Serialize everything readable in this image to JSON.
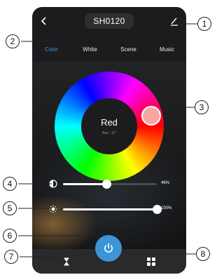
{
  "header": {
    "title": "SH0120",
    "back_icon": "chevron-left-icon",
    "edit_icon": "pencil-icon"
  },
  "tabs": [
    {
      "label": "Color",
      "active": true
    },
    {
      "label": "White",
      "active": false
    },
    {
      "label": "Scene",
      "active": false
    },
    {
      "label": "Music",
      "active": false
    }
  ],
  "color_wheel": {
    "color_name": "Red",
    "hue_label": "Hue : 11°"
  },
  "brightness": {
    "icon": "contrast-icon",
    "value_label": "46%",
    "value": 46
  },
  "warmth": {
    "icon": "sun-icon",
    "value_label": "100%",
    "value": 100
  },
  "bottom_bar": {
    "left_icon": "hourglass-icon",
    "center_icon": "power-icon",
    "right_icon": "grid-icon"
  },
  "callouts": [
    "1",
    "2",
    "3",
    "4",
    "5",
    "6",
    "7",
    "8"
  ],
  "colors": {
    "accent": "#3b95d6",
    "panel": "#1c1c1e",
    "handle": "#f6a8a0"
  }
}
